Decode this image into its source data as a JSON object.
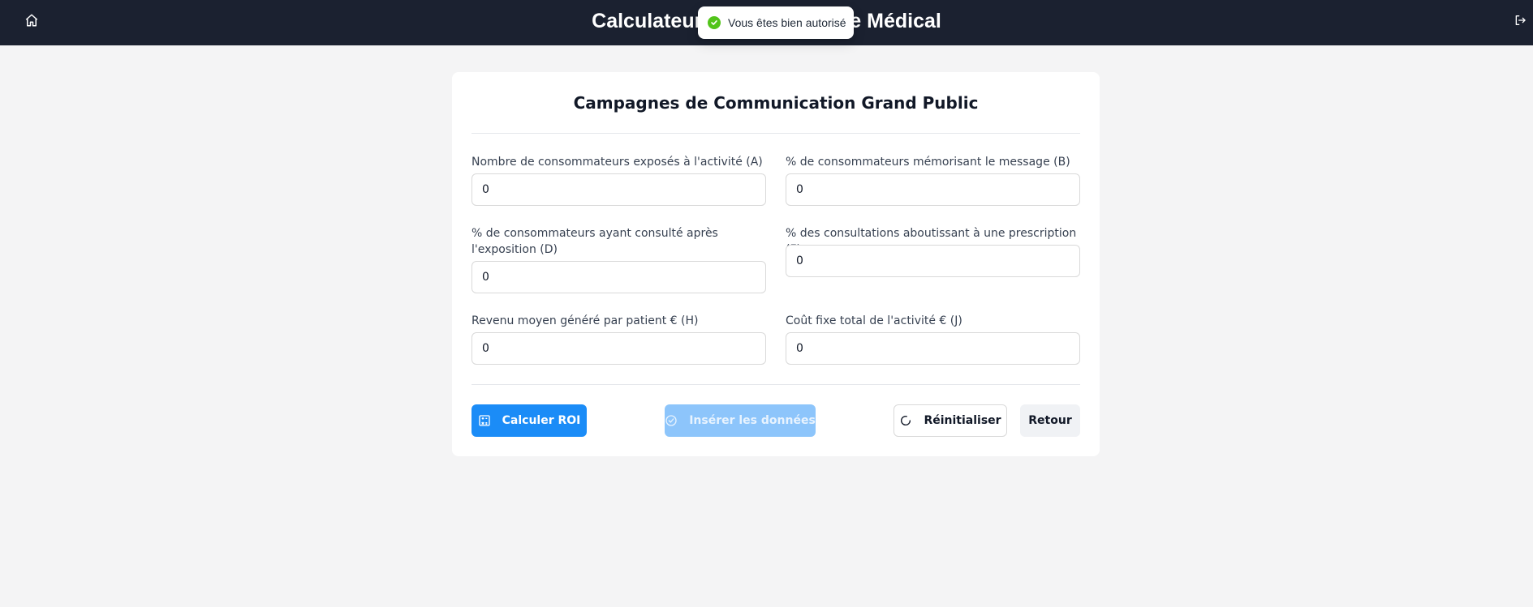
{
  "header": {
    "title": "Calculateur ROI Laboratoire Médical",
    "home_icon": "home-icon",
    "logout_icon": "logout-icon",
    "background": "#1b2130"
  },
  "toast": {
    "message": "Vous êtes bien autorisé",
    "icon": "check-circle-icon",
    "icon_color": "#52c41a"
  },
  "form": {
    "title": "Campagnes de Communication Grand Public",
    "fields": [
      {
        "label": "Nombre de consommateurs exposés à l'activité (A)",
        "value": "0"
      },
      {
        "label": "% de consommateurs mémorisant le message (B)",
        "value": "0"
      },
      {
        "label": "% de consommateurs ayant consulté après l'exposition (D)",
        "value": "0"
      },
      {
        "label": "% des consultations aboutissant à une prescription (F)",
        "value": "0"
      },
      {
        "label": "Revenu moyen généré par patient € (H)",
        "value": "0"
      },
      {
        "label": "Coût fixe total de l'activité € (J)",
        "value": "0"
      }
    ]
  },
  "actions": {
    "calculate": {
      "label": "Calculer ROI",
      "icon": "calculator-icon",
      "color": "#1b8cf7"
    },
    "insert": {
      "label": "Insérer les données",
      "icon": "check-circle-icon",
      "disabled": true
    },
    "reset": {
      "label": "Réinitialiser",
      "icon": "reload-icon"
    },
    "back": {
      "label": "Retour"
    }
  }
}
